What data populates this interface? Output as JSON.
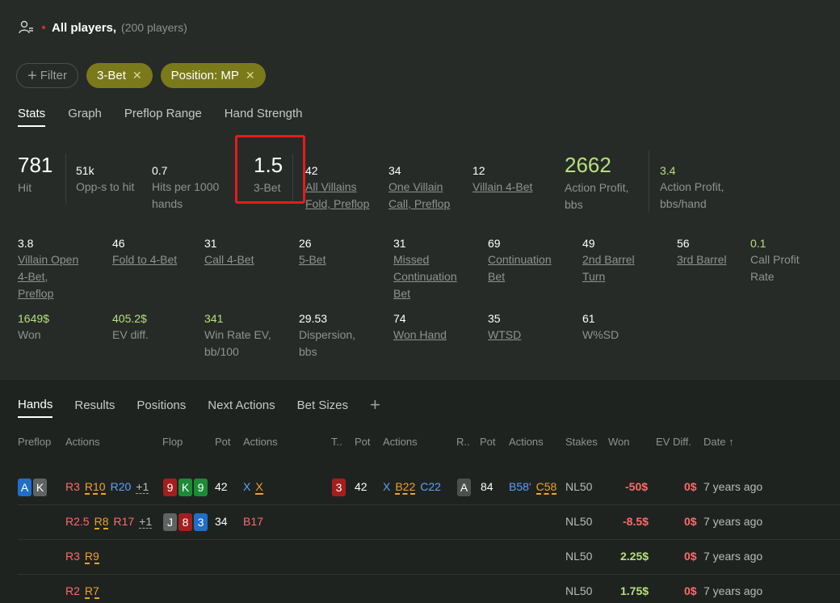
{
  "header": {
    "title": "All players,",
    "count": "(200 players)"
  },
  "filters": {
    "add_label": "Filter",
    "chips": [
      "3-Bet",
      "Position: MP"
    ]
  },
  "stats_tabs": [
    "Stats",
    "Graph",
    "Preflop Range",
    "Hand Strength"
  ],
  "stats": {
    "hit": {
      "value": "781",
      "label": "Hit"
    },
    "opps": {
      "value": "51k",
      "label": "Opp-s to hit"
    },
    "hits_per": {
      "value": "0.7",
      "label1": "Hits per 1000",
      "label2": "hands"
    },
    "three_bet": {
      "value": "1.5",
      "label": "3-Bet"
    },
    "all_villains": {
      "value": "42",
      "label1": "All Villains",
      "label2": "Fold, Preflop"
    },
    "one_villain": {
      "value": "34",
      "label1": "One Villain",
      "label2": "Call, Preflop"
    },
    "villain_4bet": {
      "value": "12",
      "label": "Villain 4-Bet"
    },
    "action_profit": {
      "value": "2662",
      "label1": "Action Profit,",
      "label2": "bbs"
    },
    "action_profit_hand": {
      "value": "3.4",
      "label1": "Action Profit,",
      "label2": "bbs/hand"
    },
    "villain_open": {
      "value": "3.8",
      "label1": "Villain Open",
      "label2": "4-Bet,",
      "label3": "Preflop"
    },
    "fold_4bet": {
      "value": "46",
      "label": "Fold to 4-Bet"
    },
    "call_4bet": {
      "value": "31",
      "label": "Call 4-Bet"
    },
    "five_bet": {
      "value": "26",
      "label": "5-Bet"
    },
    "missed_cont": {
      "value": "31",
      "label1": "Missed",
      "label2": "Continuation",
      "label3": "Bet"
    },
    "cont_bet": {
      "value": "69",
      "label1": "Continuation",
      "label2": "Bet"
    },
    "second_barrel": {
      "value": "49",
      "label1": "2nd Barrel",
      "label2": "Turn"
    },
    "third_barrel": {
      "value": "56",
      "label": "3rd Barrel"
    },
    "call_profit": {
      "value": "0.1",
      "label1": "Call Profit",
      "label2": "Rate"
    },
    "won": {
      "value": "1649$",
      "label": "Won"
    },
    "ev_diff": {
      "value": "405.2$",
      "label": "EV diff."
    },
    "win_rate": {
      "value": "341",
      "label1": "Win Rate EV,",
      "label2": "bb/100"
    },
    "dispersion": {
      "value": "29.53",
      "label1": "Dispersion,",
      "label2": "bbs"
    },
    "won_hand": {
      "value": "74",
      "label": "Won Hand"
    },
    "wtsd": {
      "value": "35",
      "label": "WTSD"
    },
    "wsd": {
      "value": "61",
      "label": "W%SD"
    }
  },
  "hands_tabs": [
    "Hands",
    "Results",
    "Positions",
    "Next Actions",
    "Bet Sizes"
  ],
  "columns": {
    "preflop": "Preflop",
    "actions1": "Actions",
    "flop": "Flop",
    "pot1": "Pot",
    "actions2": "Actions",
    "turn": "T..",
    "pot2": "Pot",
    "actions3": "Actions",
    "river": "R..",
    "pot3": "Pot",
    "actions4": "Actions",
    "stakes": "Stakes",
    "won": "Won",
    "ev": "EV Diff.",
    "date": "Date ↑"
  },
  "rows": [
    {
      "hole": [
        "A",
        "K"
      ],
      "pre": [
        "R3",
        "R10",
        "R20",
        "+1"
      ],
      "flop": [
        "9",
        "K",
        "9"
      ],
      "flop_pot": "42",
      "flop_acts": [
        "X",
        "X"
      ],
      "turn": "3",
      "turn_pot": "42",
      "turn_acts": [
        "X",
        "B22",
        "C22"
      ],
      "river": "A",
      "river_pot": "84",
      "river_acts": [
        "B58'",
        "C58"
      ],
      "stakes": "NL50",
      "won": "-50$",
      "ev": "0$",
      "date": "7 years ago"
    },
    {
      "pre": [
        "R2.5",
        "R8",
        "R17",
        "+1"
      ],
      "flop": [
        "J",
        "8",
        "3"
      ],
      "flop_pot": "34",
      "flop_acts": [
        "B17"
      ],
      "stakes": "NL50",
      "won": "-8.5$",
      "ev": "0$",
      "date": "7 years ago"
    },
    {
      "pre": [
        "R3",
        "R9"
      ],
      "stakes": "NL50",
      "won": "2.25$",
      "ev": "0$",
      "date": "7 years ago"
    },
    {
      "pre": [
        "R2",
        "R7"
      ],
      "stakes": "NL50",
      "won": "1.75$",
      "ev": "0$",
      "date": "7 years ago"
    }
  ]
}
